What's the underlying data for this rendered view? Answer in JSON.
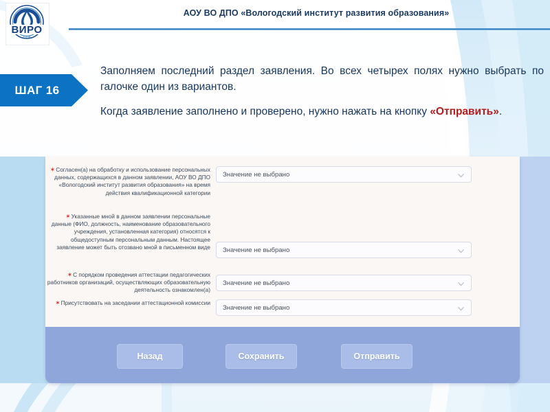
{
  "header": {
    "title": "АОУ ВО ДПО «Вологодский институт развития образования»",
    "logo_text": "ВИРО",
    "logo_year": "1938"
  },
  "step": {
    "badge_label": "ШАГ 16"
  },
  "intro": {
    "paragraph_1": "Заполняем последний раздел заявления. Во всех четырех полях нужно выбрать по галочке один из вариантов.",
    "paragraph_2_before": "Когда заявление заполнено и проверено, нужно нажать на кнопку ",
    "paragraph_2_accent": "«Отправить»",
    "paragraph_2_after": "."
  },
  "form": {
    "rows": [
      {
        "label": "Согласен(а) на обработку и использование персональных данных, содержащихся в данном заявлении, АОУ ВО ДПО «Вологодский институт развития образования» на время действия квалификационной категории",
        "value": "Значение не выбрано",
        "required": true
      },
      {
        "label": "Указанные мной в данном заявлении персональные данные (ФИО, должность, наименование образовательного учреждения, установленная категория) относятся к общедоступным персональным данным. Настоящее заявление может быть отозвано мной в письменном виде",
        "value": "Значение не выбрано",
        "required": true
      },
      {
        "label": "С порядком проведения аттестации педагогических работников организаций, осуществляющих образовательную деятельность ознакомлен(а)",
        "value": "Значение не выбрано",
        "required": true
      },
      {
        "label": "Присутствовать на заседании аттестационной комиссии",
        "value": "Значение не выбрано",
        "required": true
      }
    ],
    "required_marker": "✶"
  },
  "buttons": {
    "back": "Назад",
    "save": "Сохранить",
    "submit": "Отправить"
  },
  "colors": {
    "brand_blue": "#0b72c4",
    "header_text": "#1b3a63",
    "accent_red": "#b41d1d",
    "required_star": "#d0342c",
    "footer_blue": "#8fa6db",
    "button_blue": "#aabde8"
  }
}
